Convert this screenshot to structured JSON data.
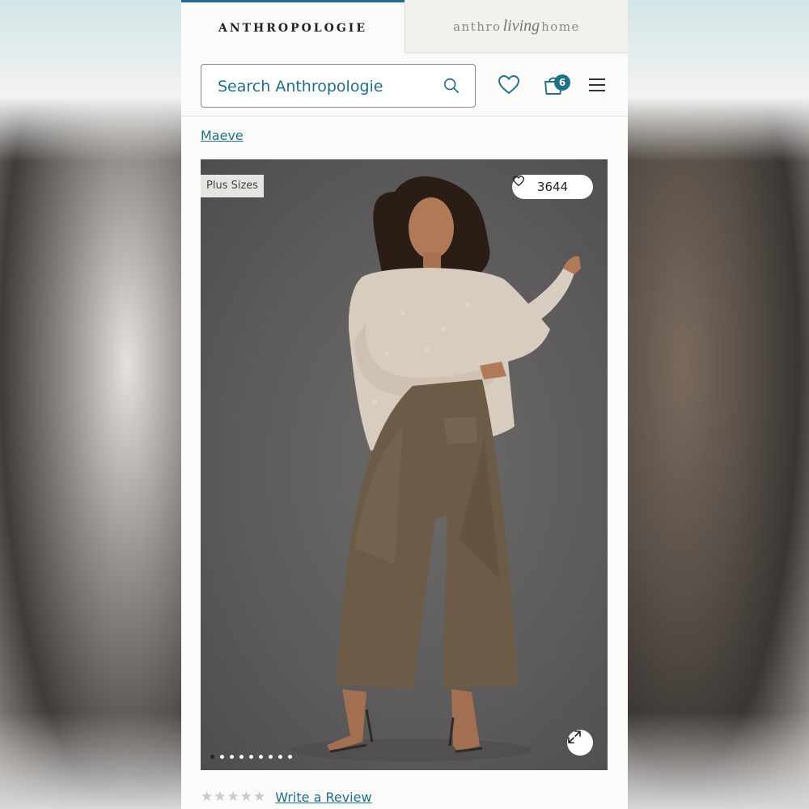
{
  "brand_tabs": {
    "main": "ANTHROPOLOGIE",
    "living_left": "anthro",
    "living_script": "living",
    "living_right": "home"
  },
  "search": {
    "placeholder": "Search Anthropologie"
  },
  "cart": {
    "count": "6"
  },
  "icons": {
    "search": "search-icon",
    "wishlist": "heart-icon",
    "cart": "shopping-bag-icon",
    "menu": "hamburger-menu-icon",
    "expand": "expand-icon"
  },
  "product": {
    "brand": "Maeve",
    "tag": "Plus Sizes",
    "likes": "3644",
    "image_count": 9,
    "active_image": 1,
    "rating": 0,
    "rating_max": 5,
    "write_review_label": "Write a Review"
  },
  "colors": {
    "accent": "#1f6f86",
    "background": "#fbfbf9"
  }
}
